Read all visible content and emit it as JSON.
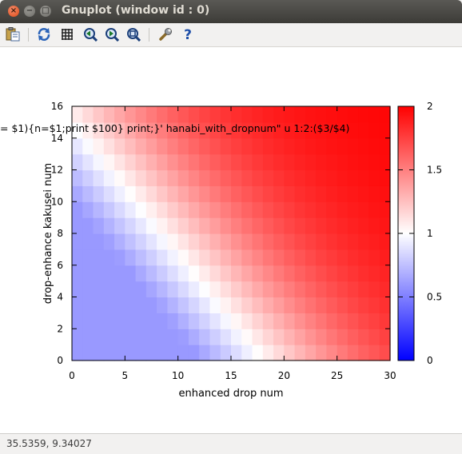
{
  "window": {
    "title": "Gnuplot (window id : 0)"
  },
  "toolbar": {
    "buttons": [
      {
        "name": "copy-clipboard-button",
        "icon": "clipboard-icon"
      },
      {
        "name": "replot-button",
        "icon": "refresh-icon"
      },
      {
        "name": "grid-button",
        "icon": "grid-icon"
      },
      {
        "name": "zoom-previous-button",
        "icon": "zoom-previous-icon"
      },
      {
        "name": "zoom-next-button",
        "icon": "zoom-next-icon"
      },
      {
        "name": "zoom-unzoom-button",
        "icon": "zoom-fit-icon"
      },
      {
        "name": "preferences-button",
        "icon": "wrench-icon"
      },
      {
        "name": "help-button",
        "icon": "help-icon"
      }
    ]
  },
  "status": {
    "text": "35.5359,  9.34027"
  },
  "chart_data": {
    "type": "heatmap",
    "title_fragment": "= $1){n=$1;print $100} print;}' hanabi_with_dropnum\" u 1:2:($3/$4)",
    "xlabel": "enhanced drop num",
    "ylabel": "drop-enhance kakusei num",
    "xlim": [
      0,
      30
    ],
    "ylim": [
      0,
      16
    ],
    "x_ticks": [
      "0",
      "5",
      "10",
      "15",
      "20",
      "25",
      "30"
    ],
    "y_ticks": [
      "0",
      "2",
      "4",
      "6",
      "8",
      "10",
      "12",
      "14",
      "16"
    ],
    "cbrange": [
      0,
      2
    ],
    "cb_ticks": [
      "0",
      "0.5",
      "1",
      "1.5",
      "2"
    ],
    "palette": [
      "#0000ff",
      "#ffffff",
      "#ff0000"
    ],
    "cells_x": [
      0,
      29
    ],
    "cells_y": [
      0,
      15
    ],
    "approx_formula": "value ≈ 1 + tanh((x + 1.2*y - 18)/14), clipped to [0.6, 1.98]"
  }
}
